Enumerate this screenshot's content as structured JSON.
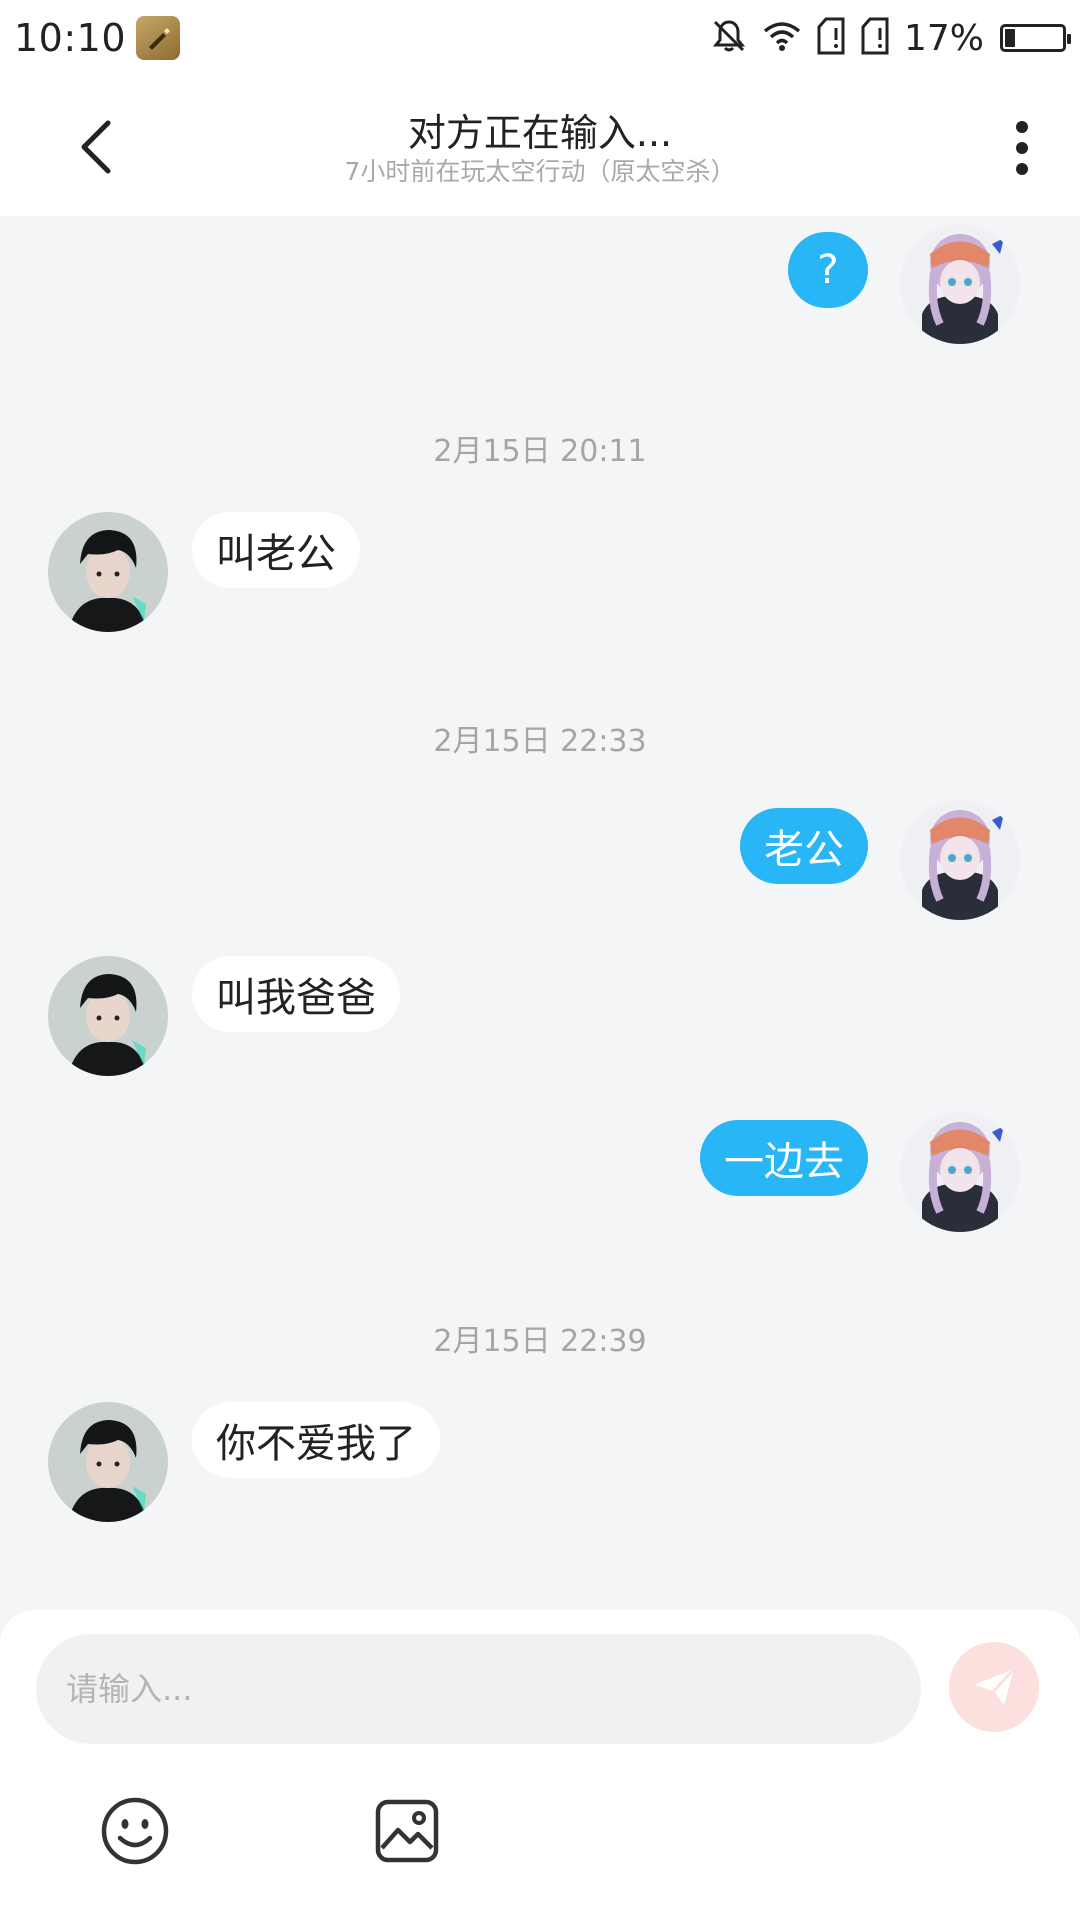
{
  "status_bar": {
    "time": "10:10",
    "battery_percent_text": "17%",
    "battery_level": 0.17,
    "icons": [
      "app-badge-icon",
      "bell-off-icon",
      "wifi-icon",
      "sim-1-icon",
      "sim-2-icon",
      "battery-icon"
    ]
  },
  "header": {
    "title": "对方正在输入...",
    "subtitle": "7小时前在玩太空行动（原太空杀）",
    "back_icon": "chevron-left-icon",
    "more_icon": "more-vertical-icon"
  },
  "chat": {
    "messages": [
      {
        "type": "outgoing",
        "text": "?"
      },
      {
        "type": "timestamp",
        "text": "2月15日 20:11"
      },
      {
        "type": "incoming",
        "text": "叫老公"
      },
      {
        "type": "timestamp",
        "text": "2月15日 22:33"
      },
      {
        "type": "outgoing",
        "text": "老公"
      },
      {
        "type": "incoming",
        "text": "叫我爸爸"
      },
      {
        "type": "outgoing",
        "text": "一边去"
      },
      {
        "type": "timestamp",
        "text": "2月15日 22:39"
      },
      {
        "type": "incoming",
        "text": "你不爱我了"
      }
    ]
  },
  "composer": {
    "placeholder": "请输入...",
    "value": "",
    "send_icon": "send-paper-plane-icon",
    "tools": [
      "emoji-icon",
      "image-icon"
    ]
  },
  "colors": {
    "outgoing_bubble": "#29b6f6",
    "incoming_bubble": "#ffffff",
    "chat_background": "#f4f5f7",
    "send_button": "#fbe0dd"
  }
}
